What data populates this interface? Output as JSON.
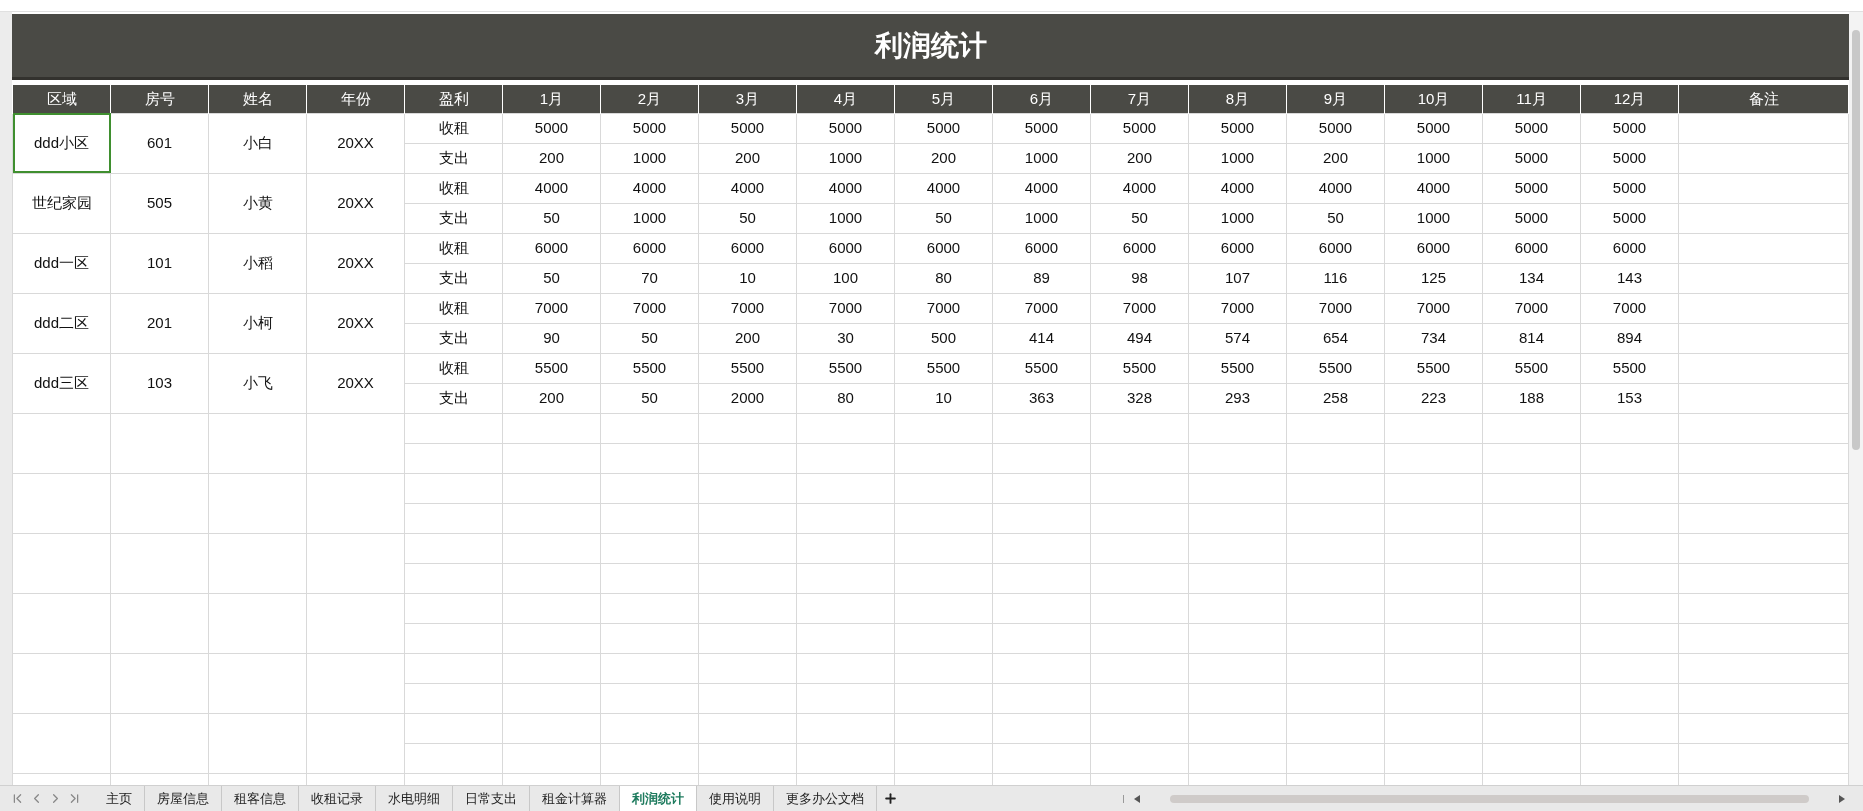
{
  "title": "利润统计",
  "columns": [
    "区域",
    "房号",
    "姓名",
    "年份",
    "盈利",
    "1月",
    "2月",
    "3月",
    "4月",
    "5月",
    "6月",
    "7月",
    "8月",
    "9月",
    "10月",
    "11月",
    "12月",
    "备注"
  ],
  "records": [
    {
      "area": "ddd小区",
      "room": "601",
      "name": "小白",
      "year": "20XX",
      "selected": true,
      "lines": [
        {
          "label": "收租",
          "values": [
            "5000",
            "5000",
            "5000",
            "5000",
            "5000",
            "5000",
            "5000",
            "5000",
            "5000",
            "5000",
            "5000",
            "5000"
          ]
        },
        {
          "label": "支出",
          "values": [
            "200",
            "1000",
            "200",
            "1000",
            "200",
            "1000",
            "200",
            "1000",
            "200",
            "1000",
            "5000",
            "5000"
          ]
        }
      ]
    },
    {
      "area": "世纪家园",
      "room": "505",
      "name": "小黄",
      "year": "20XX",
      "selected": false,
      "lines": [
        {
          "label": "收租",
          "values": [
            "4000",
            "4000",
            "4000",
            "4000",
            "4000",
            "4000",
            "4000",
            "4000",
            "4000",
            "4000",
            "5000",
            "5000"
          ]
        },
        {
          "label": "支出",
          "values": [
            "50",
            "1000",
            "50",
            "1000",
            "50",
            "1000",
            "50",
            "1000",
            "50",
            "1000",
            "5000",
            "5000"
          ]
        }
      ]
    },
    {
      "area": "ddd一区",
      "room": "101",
      "name": "小稻",
      "year": "20XX",
      "selected": false,
      "lines": [
        {
          "label": "收租",
          "values": [
            "6000",
            "6000",
            "6000",
            "6000",
            "6000",
            "6000",
            "6000",
            "6000",
            "6000",
            "6000",
            "6000",
            "6000"
          ]
        },
        {
          "label": "支出",
          "values": [
            "50",
            "70",
            "10",
            "100",
            "80",
            "89",
            "98",
            "107",
            "116",
            "125",
            "134",
            "143"
          ]
        }
      ]
    },
    {
      "area": "ddd二区",
      "room": "201",
      "name": "小柯",
      "year": "20XX",
      "selected": false,
      "lines": [
        {
          "label": "收租",
          "values": [
            "7000",
            "7000",
            "7000",
            "7000",
            "7000",
            "7000",
            "7000",
            "7000",
            "7000",
            "7000",
            "7000",
            "7000"
          ]
        },
        {
          "label": "支出",
          "values": [
            "90",
            "50",
            "200",
            "30",
            "500",
            "414",
            "494",
            "574",
            "654",
            "734",
            "814",
            "894"
          ]
        }
      ]
    },
    {
      "area": "ddd三区",
      "room": "103",
      "name": "小飞",
      "year": "20XX",
      "selected": false,
      "lines": [
        {
          "label": "收租",
          "values": [
            "5500",
            "5500",
            "5500",
            "5500",
            "5500",
            "5500",
            "5500",
            "5500",
            "5500",
            "5500",
            "5500",
            "5500"
          ]
        },
        {
          "label": "支出",
          "values": [
            "200",
            "50",
            "2000",
            "80",
            "10",
            "363",
            "328",
            "293",
            "258",
            "223",
            "188",
            "153"
          ]
        }
      ]
    }
  ],
  "sheet_tabs": [
    {
      "label": "主页",
      "selected": false
    },
    {
      "label": "房屋信息",
      "selected": false
    },
    {
      "label": "租客信息",
      "selected": false
    },
    {
      "label": "收租记录",
      "selected": false
    },
    {
      "label": "水电明细",
      "selected": false
    },
    {
      "label": "日常支出",
      "selected": false
    },
    {
      "label": "租金计算器",
      "selected": false
    },
    {
      "label": "利润统计",
      "selected": true
    },
    {
      "label": "使用说明",
      "selected": false
    },
    {
      "label": "更多办公文档",
      "selected": false
    }
  ]
}
